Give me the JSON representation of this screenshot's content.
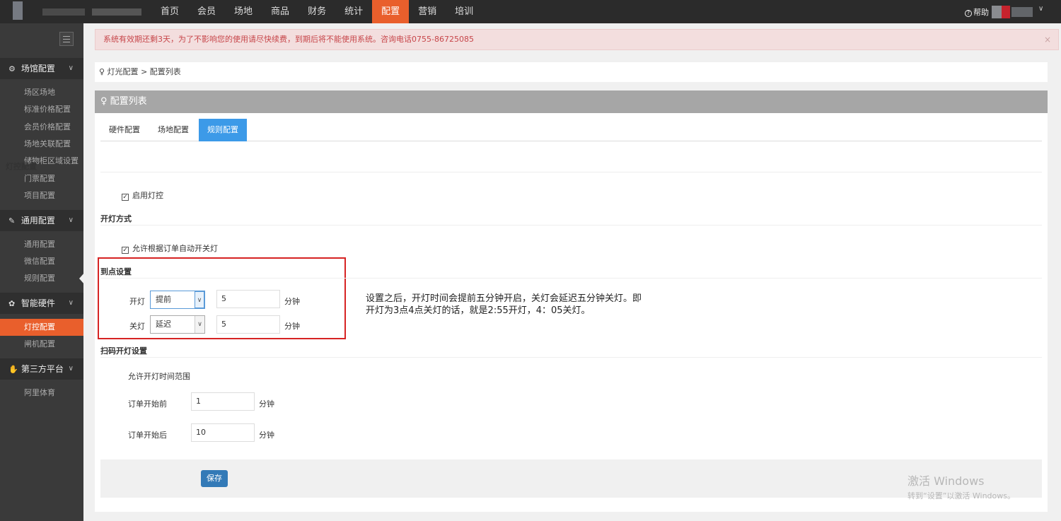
{
  "nav": {
    "items": [
      "首页",
      "会员",
      "场地",
      "商品",
      "财务",
      "统计",
      "配置",
      "营销",
      "培训"
    ],
    "active_index": 6,
    "help_label": "帮助"
  },
  "sidebar": {
    "groups": [
      {
        "label": "场馆配置",
        "icon": "gear-icon",
        "items": [
          "场区场地",
          "标准价格配置",
          "会员价格配置",
          "场地关联配置",
          "储物柜区域设置",
          "门票配置",
          "项目配置"
        ]
      },
      {
        "label": "通用配置",
        "icon": "wrench-icon",
        "items": [
          "通用配置",
          "微信配置",
          "规则配置"
        ]
      },
      {
        "label": "智能硬件",
        "icon": "cog-icon",
        "items": [
          "灯控配置",
          "闸机配置"
        ]
      },
      {
        "label": "第三方平台",
        "icon": "handshake-icon",
        "items": [
          "阿里体育"
        ]
      }
    ],
    "active_item": "灯控配置"
  },
  "alert": {
    "text": "系统有效期还剩3天，为了不影响您的使用请尽快续费，到期后将不能使用系统。咨询电话0755-86725085",
    "close": "×"
  },
  "breadcrumb": {
    "icon": "lightbulb-icon",
    "path": "灯光配置",
    "separator": ">",
    "current": "配置列表"
  },
  "panel": {
    "title": "配置列表",
    "tabs": [
      "硬件配置",
      "场地配置",
      "规则配置"
    ],
    "active_tab": 2
  },
  "light_control": {
    "title": "灯控配置",
    "enable_label": "启用灯控",
    "enabled": true
  },
  "open_mode": {
    "title": "开灯方式",
    "auto_label": "允许根据订单自动开关灯",
    "auto": true
  },
  "timing": {
    "title": "到点设置",
    "on_label": "开灯",
    "on_mode": "提前",
    "on_minutes": "5",
    "off_label": "关灯",
    "off_mode": "延迟",
    "off_minutes": "5",
    "unit": "分钟"
  },
  "note": {
    "line1": "设置之后，开灯时间会提前五分钟开启，关灯会延迟五分钟关灯。即",
    "line2": "开灯为3点4点关灯的话，就是2:55开灯，4：05关灯。"
  },
  "scan": {
    "title": "扫码开灯设置",
    "range_label": "允许开灯时间范围",
    "before_label": "订单开始前",
    "before_value": "1",
    "after_label": "订单开始后",
    "after_value": "10",
    "unit": "分钟"
  },
  "actions": {
    "save_label": "保存"
  },
  "watermark": {
    "line1": "激活 Windows",
    "line2": "转到“设置”以激活 Windows。"
  }
}
